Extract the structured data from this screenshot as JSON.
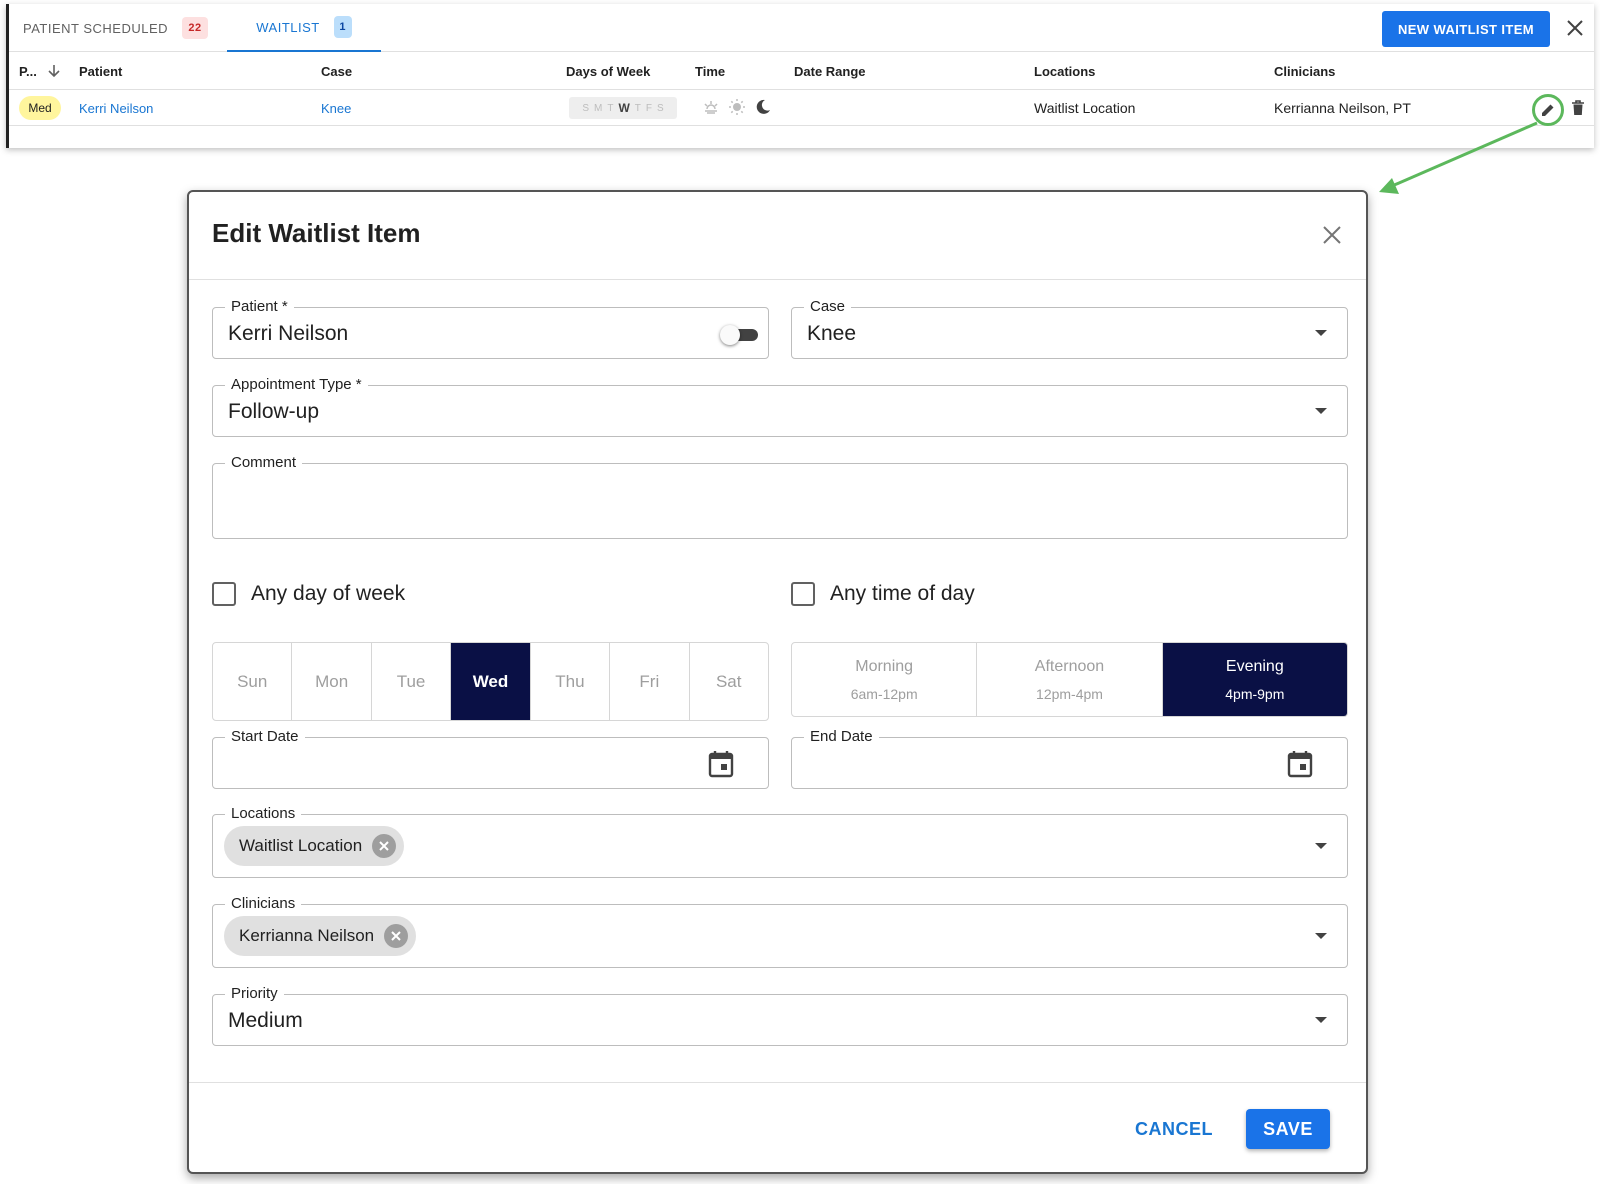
{
  "tabs": {
    "scheduled_label": "PATIENT SCHEDULED",
    "scheduled_count": "22",
    "waitlist_label": "WAITLIST",
    "waitlist_count": "1"
  },
  "toolbar": {
    "new_item_label": "NEW WAITLIST ITEM"
  },
  "table": {
    "headers": {
      "priority": "P...",
      "patient": "Patient",
      "case": "Case",
      "days": "Days of Week",
      "time": "Time",
      "date_range": "Date Range",
      "locations": "Locations",
      "clinicians": "Clinicians"
    },
    "row": {
      "priority": "Med",
      "patient": "Kerri Neilson",
      "case": "Knee",
      "days": [
        "S",
        "M",
        "T",
        "W",
        "T",
        "F",
        "S"
      ],
      "selected_day_index": 3,
      "date_range": "",
      "location": "Waitlist Location",
      "clinician": "Kerrianna Neilson, PT"
    }
  },
  "modal": {
    "title": "Edit Waitlist Item",
    "patient": {
      "label": "Patient *",
      "value": "Kerri Neilson"
    },
    "case": {
      "label": "Case",
      "value": "Knee"
    },
    "appointment_type": {
      "label": "Appointment Type *",
      "value": "Follow-up"
    },
    "comment": {
      "label": "Comment",
      "value": ""
    },
    "any_day_label": "Any day of week",
    "any_time_label": "Any time of day",
    "days": [
      {
        "label": "Sun",
        "selected": false
      },
      {
        "label": "Mon",
        "selected": false
      },
      {
        "label": "Tue",
        "selected": false
      },
      {
        "label": "Wed",
        "selected": true
      },
      {
        "label": "Thu",
        "selected": false
      },
      {
        "label": "Fri",
        "selected": false
      },
      {
        "label": "Sat",
        "selected": false
      }
    ],
    "times": [
      {
        "label": "Morning",
        "range": "6am-12pm",
        "selected": false
      },
      {
        "label": "Afternoon",
        "range": "12pm-4pm",
        "selected": false
      },
      {
        "label": "Evening",
        "range": "4pm-9pm",
        "selected": true
      }
    ],
    "start_date": {
      "label": "Start Date",
      "value": ""
    },
    "end_date": {
      "label": "End Date",
      "value": ""
    },
    "locations": {
      "label": "Locations",
      "chip": "Waitlist Location"
    },
    "clinicians": {
      "label": "Clinicians",
      "chip": "Kerrianna Neilson"
    },
    "priority": {
      "label": "Priority",
      "value": "Medium"
    },
    "cancel_label": "CANCEL",
    "save_label": "SAVE"
  },
  "colors": {
    "accent": "#1a73e8",
    "selected_dark": "#0a1045",
    "annotation_green": "#5cb85c",
    "priority_badge": "#fff59d"
  },
  "icons": [
    "sort-arrow-down-icon",
    "sunrise-icon",
    "sun-icon",
    "moon-icon",
    "pencil-icon",
    "trash-icon",
    "close-icon",
    "calendar-icon",
    "chip-remove-icon",
    "dropdown-caret-icon"
  ]
}
